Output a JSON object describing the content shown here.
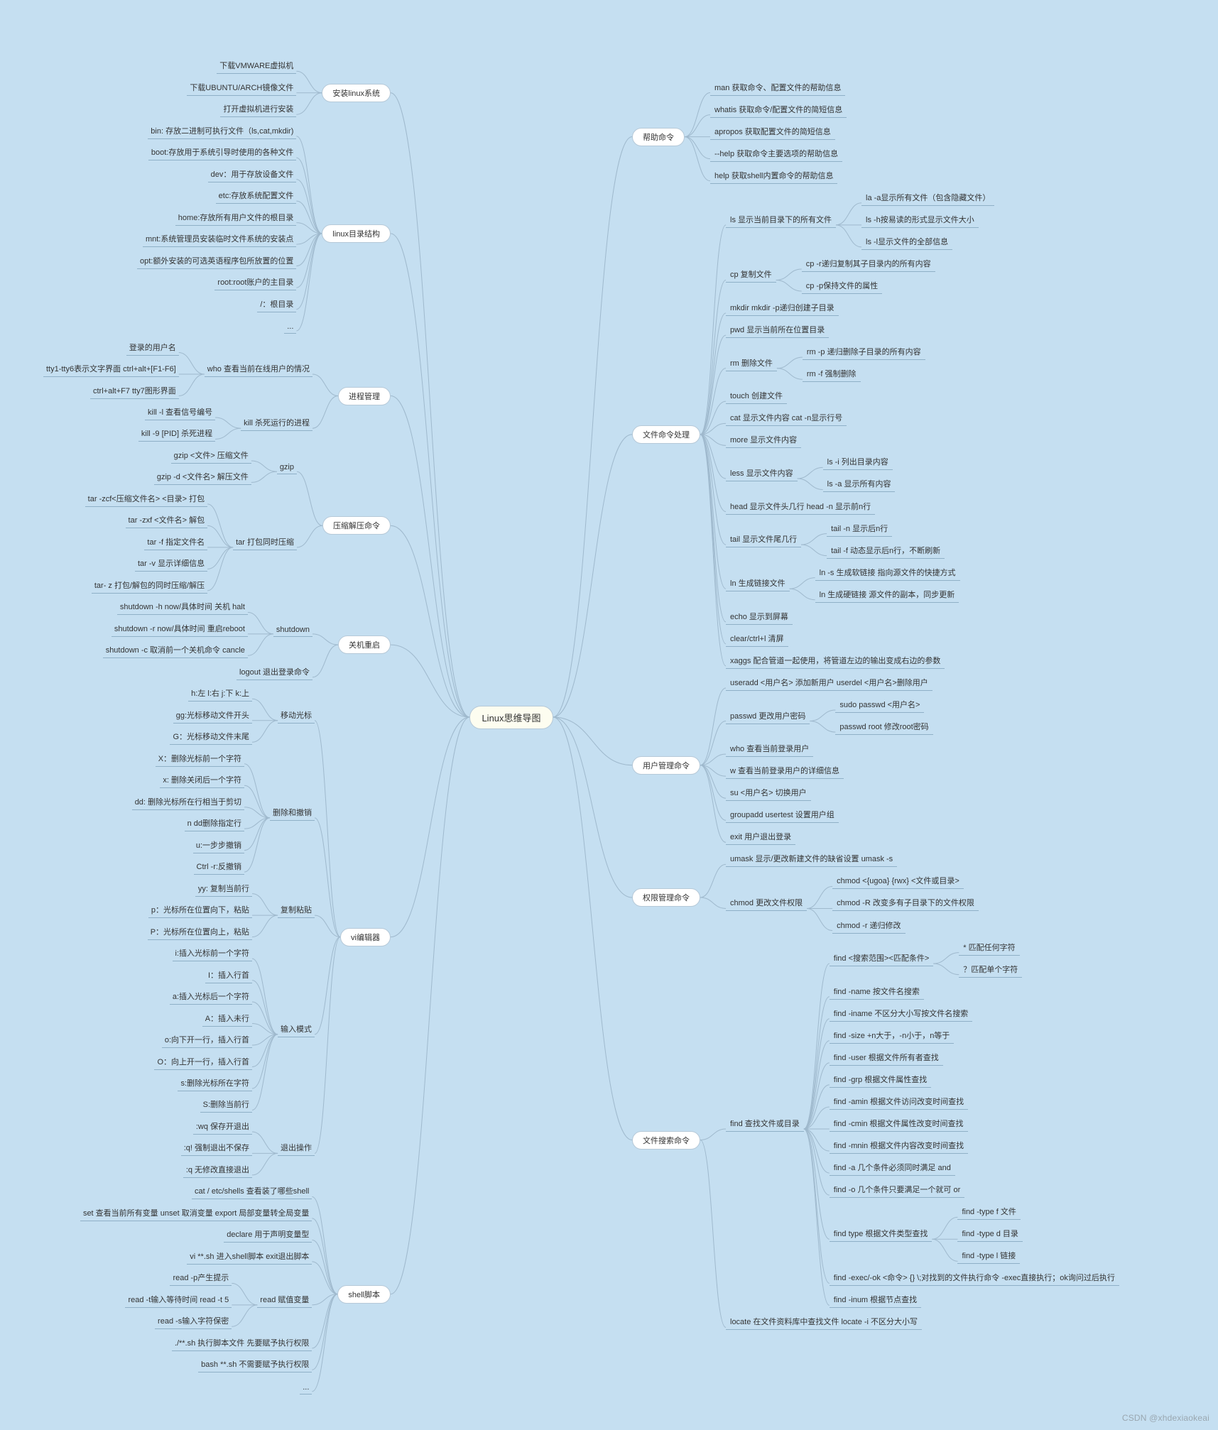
{
  "credit": "CSDN @xhdexiaokeai",
  "root": {
    "label": "Linux思维导图"
  },
  "leftBranches": [
    {
      "label": "安装linux系统",
      "children": [
        {
          "text": "下载VMWARE虚拟机"
        },
        {
          "text": "下载UBUNTU/ARCH镜像文件"
        },
        {
          "text": "打开虚拟机进行安装"
        }
      ]
    },
    {
      "label": "linux目录结构",
      "children": [
        {
          "text": "bin: 存放二进制可执行文件（ls,cat,mkdir)"
        },
        {
          "text": "boot:存放用于系统引导时使用的各种文件"
        },
        {
          "text": "dev：用于存放设备文件"
        },
        {
          "text": "etc:存放系统配置文件"
        },
        {
          "text": "home:存放所有用户文件的根目录"
        },
        {
          "text": "mnt:系统管理员安装临时文件系统的安装点"
        },
        {
          "text": "opt:额外安装的可选英语程序包所放置的位置"
        },
        {
          "text": "root:root账户的主目录"
        },
        {
          "text": "/：根目录"
        },
        {
          "text": "..."
        }
      ]
    },
    {
      "label": "进程管理",
      "children": [
        {
          "text": "who 查看当前在线用户的情况",
          "children": [
            {
              "text": "登录的用户名"
            },
            {
              "text": "tty1-tty6表示文字界面 ctrl+alt+[F1-F6]"
            },
            {
              "text": "ctrl+alt+F7     tty7图形界面"
            }
          ]
        },
        {
          "text": "kill 杀死运行的进程",
          "children": [
            {
              "text": "kill -l 查看信号编号"
            },
            {
              "text": "kill -9 [PID] 杀死进程"
            }
          ]
        }
      ]
    },
    {
      "label": "压缩解压命令",
      "children": [
        {
          "text": "gzip",
          "children": [
            {
              "text": "gzip <文件> 压缩文件"
            },
            {
              "text": "gzip -d <文件名> 解压文件"
            }
          ]
        },
        {
          "text": "tar 打包同时压缩",
          "children": [
            {
              "text": "tar -zcf<压缩文件名> <目录> 打包"
            },
            {
              "text": "tar -zxf <文件名> 解包"
            },
            {
              "text": "tar -f 指定文件名"
            },
            {
              "text": "tar -v 显示详细信息"
            },
            {
              "text": "tar- z 打包/解包的同时压缩/解压"
            }
          ]
        }
      ]
    },
    {
      "label": "关机重启",
      "children": [
        {
          "text": "shutdown",
          "children": [
            {
              "text": "shutdown -h now/具体时间 关机 halt"
            },
            {
              "text": "shutdown -r now/具体时间 重启reboot"
            },
            {
              "text": "shutdown -c 取消前一个关机命令 cancle"
            }
          ]
        },
        {
          "text": "logout 退出登录命令"
        }
      ]
    },
    {
      "label": "vi编辑器",
      "children": [
        {
          "text": "移动光标",
          "children": [
            {
              "text": "h:左 l:右 j:下 k:上"
            },
            {
              "text": "gg:光标移动文件开头"
            },
            {
              "text": "G：光标移动文件末尾"
            }
          ]
        },
        {
          "text": "删除和撤销",
          "children": [
            {
              "text": "X：删除光标前一个字符"
            },
            {
              "text": "x: 删除关闭后一个字符"
            },
            {
              "text": "dd: 删除光标所在行相当于剪切"
            },
            {
              "text": "n dd删除指定行"
            },
            {
              "text": "u:一步步撤销"
            },
            {
              "text": "Ctrl -r:反撤销"
            }
          ]
        },
        {
          "text": "复制粘贴",
          "children": [
            {
              "text": "yy: 复制当前行"
            },
            {
              "text": "p：光标所在位置向下，粘贴"
            },
            {
              "text": "P：光标所在位置向上，粘贴"
            }
          ]
        },
        {
          "text": "输入模式",
          "children": [
            {
              "text": "i:插入光标前一个字符"
            },
            {
              "text": "I：插入行首"
            },
            {
              "text": "a:插入光标后一个字符"
            },
            {
              "text": "A：插入未行"
            },
            {
              "text": "o:向下开一行，插入行首"
            },
            {
              "text": "O：向上开一行，插入行首"
            },
            {
              "text": "s:删除光标所在字符"
            },
            {
              "text": "S:删除当前行"
            }
          ]
        },
        {
          "text": "退出操作",
          "children": [
            {
              "text": ":wq 保存开退出"
            },
            {
              "text": ":q! 强制退出不保存"
            },
            {
              "text": ":q 无修改直接退出"
            }
          ]
        }
      ]
    },
    {
      "label": "shell脚本",
      "children": [
        {
          "text": "cat / etc/shells 查看装了哪些shell"
        },
        {
          "text": "set 查看当前所有变量 unset 取消变量  export 局部变量转全局变量"
        },
        {
          "text": "declare 用于声明变量型"
        },
        {
          "text": "vi **.sh 进入shell脚本 exit退出脚本"
        },
        {
          "text": "read 赋值变量",
          "children": [
            {
              "text": "read -p产生提示"
            },
            {
              "text": "read -t输入等待时间 read -t 5"
            },
            {
              "text": "read -s输入字符保密"
            }
          ]
        },
        {
          "text": "./**.sh 执行脚本文件 先要赋予执行权限"
        },
        {
          "text": "bash **.sh 不需要赋予执行权限"
        },
        {
          "text": "..."
        }
      ]
    }
  ],
  "rightBranches": [
    {
      "label": "帮助命令",
      "children": [
        {
          "text": "man 获取命令、配置文件的帮助信息"
        },
        {
          "text": "whatis 获取命令/配置文件的简短信息"
        },
        {
          "text": "apropos 获取配置文件的简短信息"
        },
        {
          "text": "--help 获取命令主要选项的帮助信息"
        },
        {
          "text": "help 获取shell内置命令的帮助信息"
        }
      ]
    },
    {
      "label": "文件命令处理",
      "children": [
        {
          "text": "ls 显示当前目录下的所有文件",
          "children": [
            {
              "text": "la -a显示所有文件（包含隐藏文件）"
            },
            {
              "text": "ls -h按易读的形式显示文件大小"
            },
            {
              "text": "ls -l显示文件的全部信息"
            }
          ]
        },
        {
          "text": "cp 复制文件",
          "children": [
            {
              "text": "cp -r递归复制其子目录内的所有内容"
            },
            {
              "text": "cp -p保持文件的属性"
            }
          ]
        },
        {
          "text": "mkdir       mkdir -p递归创建子目录"
        },
        {
          "text": "pwd 显示当前所在位置目录"
        },
        {
          "text": "rm  删除文件",
          "children": [
            {
              "text": "rm -p 递归删除子目录的所有内容"
            },
            {
              "text": "rm -f 强制删除"
            }
          ]
        },
        {
          "text": "touch 创建文件"
        },
        {
          "text": "cat 显示文件内容        cat -n显示行号"
        },
        {
          "text": "more 显示文件内容"
        },
        {
          "text": "less 显示文件内容",
          "children": [
            {
              "text": "ls -i 列出目录内容"
            },
            {
              "text": "ls -a 显示所有内容"
            }
          ]
        },
        {
          "text": "head 显示文件头几行     head -n 显示前n行"
        },
        {
          "text": "tail 显示文件尾几行",
          "children": [
            {
              "text": "tail -n 显示后n行"
            },
            {
              "text": "tail -f 动态显示后n行，不断刷新"
            }
          ]
        },
        {
          "text": "ln 生成链接文件",
          "children": [
            {
              "text": "ln -s 生成软链接     指向源文件的快捷方式"
            },
            {
              "text": "ln 生成硬链接        源文件的副本，同步更新"
            }
          ]
        },
        {
          "text": "echo 显示到屏幕"
        },
        {
          "text": "clear/ctrl+l 清屏"
        },
        {
          "text": "xaggs 配合管道一起使用，将管道左边的输出变成右边的参数"
        }
      ]
    },
    {
      "label": "用户管理命令",
      "children": [
        {
          "text": "useradd <用户名> 添加新用户       userdel <用户名>删除用户"
        },
        {
          "text": "passwd 更改用户密码",
          "children": [
            {
              "text": "sudo passwd <用户名>"
            },
            {
              "text": "passwd root 修改root密码"
            }
          ]
        },
        {
          "text": "who 查看当前登录用户"
        },
        {
          "text": "w 查看当前登录用户的详细信息"
        },
        {
          "text": "su <用户名> 切换用户"
        },
        {
          "text": "groupadd usertest  设置用户组"
        },
        {
          "text": "exit 用户退出登录"
        }
      ]
    },
    {
      "label": "权限管理命令",
      "children": [
        {
          "text": "umask 显示/更改新建文件的缺省设置         umask -s"
        },
        {
          "text": "chmod 更改文件权限",
          "children": [
            {
              "text": "chmod <{ugoa} {rwx} <文件或目录>"
            },
            {
              "text": "chmod -R 改变多有子目录下的文件权限"
            },
            {
              "text": "chmod -r 递归修改"
            }
          ]
        }
      ]
    },
    {
      "label": "文件搜索命令",
      "children": [
        {
          "text": "find 查找文件或目录",
          "children": [
            {
              "text": "find <搜索范围><匹配条件>",
              "children": [
                {
                  "text": "* 匹配任何字符"
                },
                {
                  "text": "？匹配单个字符"
                }
              ]
            },
            {
              "text": "find -name 按文件名搜索"
            },
            {
              "text": "find -iname         不区分大小写按文件名搜索"
            },
            {
              "text": "find -size  +n大于，-n小于，n等于"
            },
            {
              "text": "find -user 根据文件所有者查找"
            },
            {
              "text": "find -grp 根据文件属性查找"
            },
            {
              "text": "find -amin 根据文件访问改变时间查找"
            },
            {
              "text": "find -cmin 根据文件属性改变时间查找"
            },
            {
              "text": "find -mnin 根据文件内容改变时间查找"
            },
            {
              "text": "find -a 几个条件必须同时满足 and"
            },
            {
              "text": "find -o 几个条件只要满足一个就可 or"
            },
            {
              "text": "find type 根据文件类型查找",
              "children": [
                {
                  "text": "find -type f 文件"
                },
                {
                  "text": "find -type d 目录"
                },
                {
                  "text": "find -type l 链接"
                }
              ]
            },
            {
              "text": "find -exec/-ok <命令> {} \\;对找到的文件执行命令         -exec直接执行；ok询问过后执行"
            },
            {
              "text": "find -inum 根据节点查找"
            }
          ]
        },
        {
          "text": "locate 在文件资料库中查找文件         locate -i 不区分大小写"
        }
      ]
    }
  ]
}
